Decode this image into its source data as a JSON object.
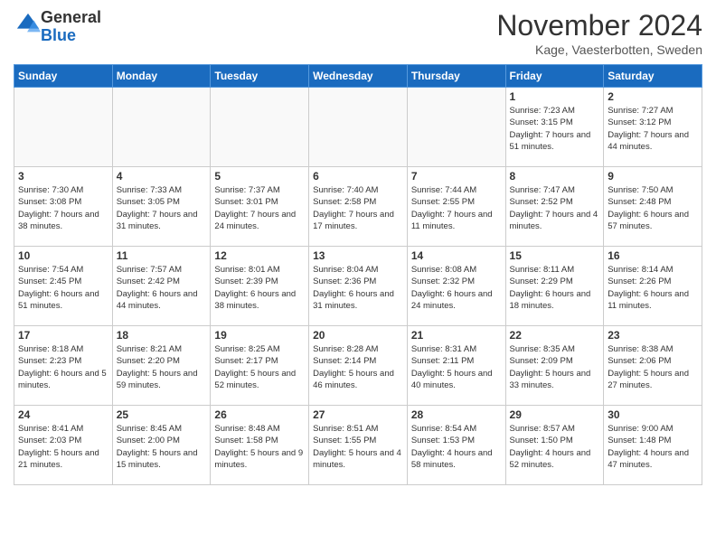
{
  "header": {
    "logo": {
      "line1": "General",
      "line2": "Blue"
    },
    "title": "November 2024",
    "subtitle": "Kage, Vaesterbotten, Sweden"
  },
  "weekdays": [
    "Sunday",
    "Monday",
    "Tuesday",
    "Wednesday",
    "Thursday",
    "Friday",
    "Saturday"
  ],
  "weeks": [
    [
      {
        "day": "",
        "info": ""
      },
      {
        "day": "",
        "info": ""
      },
      {
        "day": "",
        "info": ""
      },
      {
        "day": "",
        "info": ""
      },
      {
        "day": "",
        "info": ""
      },
      {
        "day": "1",
        "info": "Sunrise: 7:23 AM\nSunset: 3:15 PM\nDaylight: 7 hours and 51 minutes."
      },
      {
        "day": "2",
        "info": "Sunrise: 7:27 AM\nSunset: 3:12 PM\nDaylight: 7 hours and 44 minutes."
      }
    ],
    [
      {
        "day": "3",
        "info": "Sunrise: 7:30 AM\nSunset: 3:08 PM\nDaylight: 7 hours and 38 minutes."
      },
      {
        "day": "4",
        "info": "Sunrise: 7:33 AM\nSunset: 3:05 PM\nDaylight: 7 hours and 31 minutes."
      },
      {
        "day": "5",
        "info": "Sunrise: 7:37 AM\nSunset: 3:01 PM\nDaylight: 7 hours and 24 minutes."
      },
      {
        "day": "6",
        "info": "Sunrise: 7:40 AM\nSunset: 2:58 PM\nDaylight: 7 hours and 17 minutes."
      },
      {
        "day": "7",
        "info": "Sunrise: 7:44 AM\nSunset: 2:55 PM\nDaylight: 7 hours and 11 minutes."
      },
      {
        "day": "8",
        "info": "Sunrise: 7:47 AM\nSunset: 2:52 PM\nDaylight: 7 hours and 4 minutes."
      },
      {
        "day": "9",
        "info": "Sunrise: 7:50 AM\nSunset: 2:48 PM\nDaylight: 6 hours and 57 minutes."
      }
    ],
    [
      {
        "day": "10",
        "info": "Sunrise: 7:54 AM\nSunset: 2:45 PM\nDaylight: 6 hours and 51 minutes."
      },
      {
        "day": "11",
        "info": "Sunrise: 7:57 AM\nSunset: 2:42 PM\nDaylight: 6 hours and 44 minutes."
      },
      {
        "day": "12",
        "info": "Sunrise: 8:01 AM\nSunset: 2:39 PM\nDaylight: 6 hours and 38 minutes."
      },
      {
        "day": "13",
        "info": "Sunrise: 8:04 AM\nSunset: 2:36 PM\nDaylight: 6 hours and 31 minutes."
      },
      {
        "day": "14",
        "info": "Sunrise: 8:08 AM\nSunset: 2:32 PM\nDaylight: 6 hours and 24 minutes."
      },
      {
        "day": "15",
        "info": "Sunrise: 8:11 AM\nSunset: 2:29 PM\nDaylight: 6 hours and 18 minutes."
      },
      {
        "day": "16",
        "info": "Sunrise: 8:14 AM\nSunset: 2:26 PM\nDaylight: 6 hours and 11 minutes."
      }
    ],
    [
      {
        "day": "17",
        "info": "Sunrise: 8:18 AM\nSunset: 2:23 PM\nDaylight: 6 hours and 5 minutes."
      },
      {
        "day": "18",
        "info": "Sunrise: 8:21 AM\nSunset: 2:20 PM\nDaylight: 5 hours and 59 minutes."
      },
      {
        "day": "19",
        "info": "Sunrise: 8:25 AM\nSunset: 2:17 PM\nDaylight: 5 hours and 52 minutes."
      },
      {
        "day": "20",
        "info": "Sunrise: 8:28 AM\nSunset: 2:14 PM\nDaylight: 5 hours and 46 minutes."
      },
      {
        "day": "21",
        "info": "Sunrise: 8:31 AM\nSunset: 2:11 PM\nDaylight: 5 hours and 40 minutes."
      },
      {
        "day": "22",
        "info": "Sunrise: 8:35 AM\nSunset: 2:09 PM\nDaylight: 5 hours and 33 minutes."
      },
      {
        "day": "23",
        "info": "Sunrise: 8:38 AM\nSunset: 2:06 PM\nDaylight: 5 hours and 27 minutes."
      }
    ],
    [
      {
        "day": "24",
        "info": "Sunrise: 8:41 AM\nSunset: 2:03 PM\nDaylight: 5 hours and 21 minutes."
      },
      {
        "day": "25",
        "info": "Sunrise: 8:45 AM\nSunset: 2:00 PM\nDaylight: 5 hours and 15 minutes."
      },
      {
        "day": "26",
        "info": "Sunrise: 8:48 AM\nSunset: 1:58 PM\nDaylight: 5 hours and 9 minutes."
      },
      {
        "day": "27",
        "info": "Sunrise: 8:51 AM\nSunset: 1:55 PM\nDaylight: 5 hours and 4 minutes."
      },
      {
        "day": "28",
        "info": "Sunrise: 8:54 AM\nSunset: 1:53 PM\nDaylight: 4 hours and 58 minutes."
      },
      {
        "day": "29",
        "info": "Sunrise: 8:57 AM\nSunset: 1:50 PM\nDaylight: 4 hours and 52 minutes."
      },
      {
        "day": "30",
        "info": "Sunrise: 9:00 AM\nSunset: 1:48 PM\nDaylight: 4 hours and 47 minutes."
      }
    ]
  ]
}
